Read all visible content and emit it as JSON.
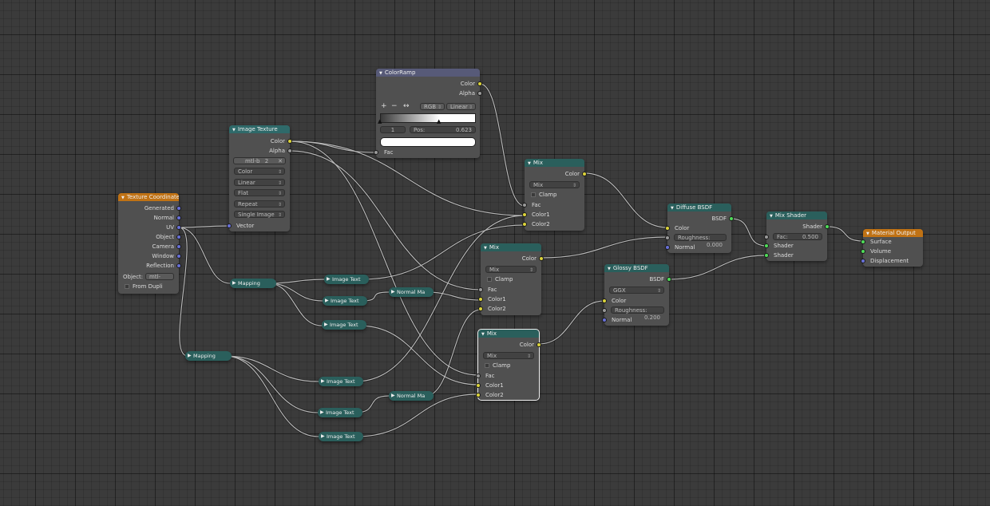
{
  "nodes": {
    "texcoord": {
      "title": "Texture Coordinate",
      "outputs": [
        "Generated",
        "Normal",
        "UV",
        "Object",
        "Camera",
        "Window",
        "Reflection"
      ],
      "object_label": "Object:",
      "object_value": "mtl-",
      "from_dupli": "From Dupli"
    },
    "imagetex": {
      "title": "Image Texture",
      "outputs": [
        "Color",
        "Alpha"
      ],
      "image_name": "mtl-b",
      "users": "2",
      "fields": [
        "Color",
        "Linear",
        "Flat",
        "Repeat",
        "Single Image"
      ],
      "input": "Vector"
    },
    "colorramp": {
      "title": "ColorRamp",
      "outputs": [
        "Color",
        "Alpha"
      ],
      "plus": "+",
      "minus": "−",
      "flip": "↔",
      "mode": "RGB",
      "interp": "Linear",
      "index": "1",
      "pos_label": "Pos:",
      "pos_value": "0.623",
      "input": "Fac"
    },
    "mix1": {
      "title": "Mix",
      "output": "Color",
      "blend": "Mix",
      "clamp": "Clamp",
      "inputs": [
        "Fac",
        "Color1",
        "Color2"
      ]
    },
    "mix2": {
      "title": "Mix",
      "output": "Color",
      "blend": "Mix",
      "clamp": "Clamp",
      "inputs": [
        "Fac",
        "Color1",
        "Color2"
      ]
    },
    "mix3": {
      "title": "Mix",
      "output": "Color",
      "blend": "Mix",
      "clamp": "Clamp",
      "inputs": [
        "Fac",
        "Color1",
        "Color2"
      ]
    },
    "diffuse": {
      "title": "Diffuse BSDF",
      "output": "BSDF",
      "inputs": [
        "Color"
      ],
      "rough_label": "Roughness:",
      "rough_value": "0.000",
      "normal": "Normal"
    },
    "glossy": {
      "title": "Glossy BSDF",
      "output": "BSDF",
      "dist": "GGX",
      "color": "Color",
      "rough_label": "Roughness:",
      "rough_value": "0.200",
      "normal": "Normal"
    },
    "mixshader": {
      "title": "Mix Shader",
      "output": "Shader",
      "fac_label": "Fac:",
      "fac_value": "0.500",
      "inputs": [
        "Shader",
        "Shader"
      ]
    },
    "matout": {
      "title": "Material Output",
      "inputs": [
        "Surface",
        "Volume",
        "Displacement"
      ]
    }
  },
  "reroutes": {
    "mapping1": "Mapping",
    "mapping2": "Mapping",
    "it1": "Image Text",
    "it2": "Image Text",
    "it3": "Image Text",
    "it4": "Image Text",
    "it5": "Image Text",
    "it6": "Image Text",
    "nm1": "Normal Ma",
    "nm2": "Normal Ma"
  },
  "colors": {
    "background": "#3b3b3b",
    "wire": "#b8b8b8",
    "header_shader": "#2a5f5c",
    "header_output": "#c07214",
    "header_converter": "#575a78"
  }
}
